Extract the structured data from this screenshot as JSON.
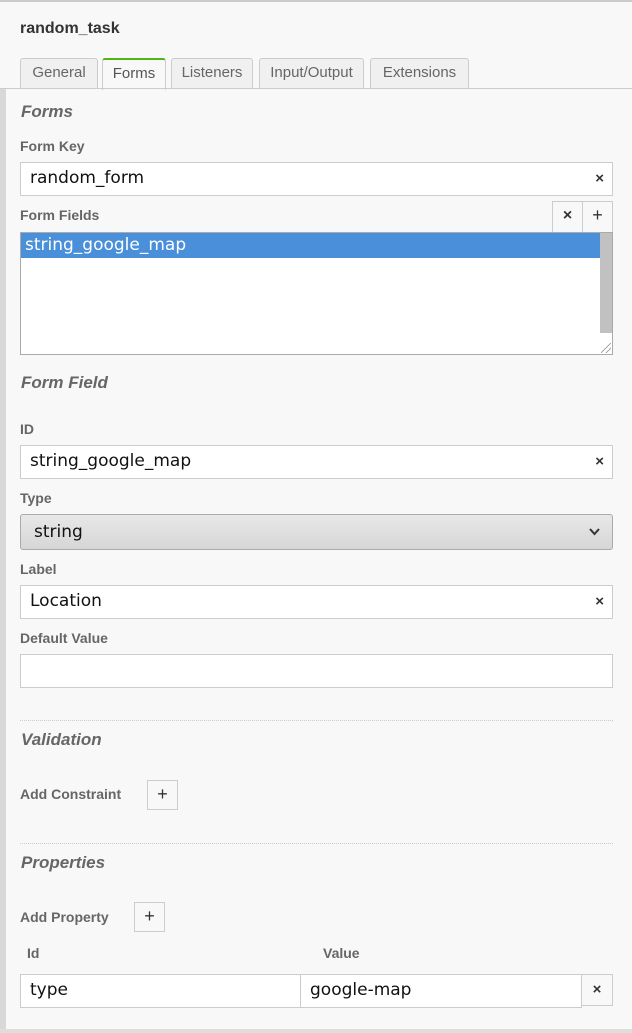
{
  "title": "random_task",
  "tabs": [
    {
      "label": "General"
    },
    {
      "label": "Forms"
    },
    {
      "label": "Listeners"
    },
    {
      "label": "Input/Output"
    },
    {
      "label": "Extensions"
    }
  ],
  "active_tab": "Forms",
  "forms": {
    "heading": "Forms",
    "form_key_label": "Form Key",
    "form_key_value": "random_form",
    "form_fields_label": "Form Fields",
    "form_fields": [
      "string_google_map"
    ],
    "selected_field": "string_google_map"
  },
  "form_field": {
    "heading": "Form Field",
    "id_label": "ID",
    "id_value": "string_google_map",
    "type_label": "Type",
    "type_value": "string",
    "label_label": "Label",
    "label_value": "Location",
    "default_label": "Default Value",
    "default_value": ""
  },
  "validation": {
    "heading": "Validation",
    "add_label": "Add Constraint"
  },
  "properties": {
    "heading": "Properties",
    "add_label": "Add Property",
    "col_id": "Id",
    "col_value": "Value",
    "rows": [
      {
        "id": "type",
        "value": "google-map"
      }
    ]
  },
  "icons": {
    "clear": "×",
    "add": "+",
    "chevron": "⌄"
  },
  "colors": {
    "accent": "#52b415",
    "selection": "#4a8fd9"
  }
}
